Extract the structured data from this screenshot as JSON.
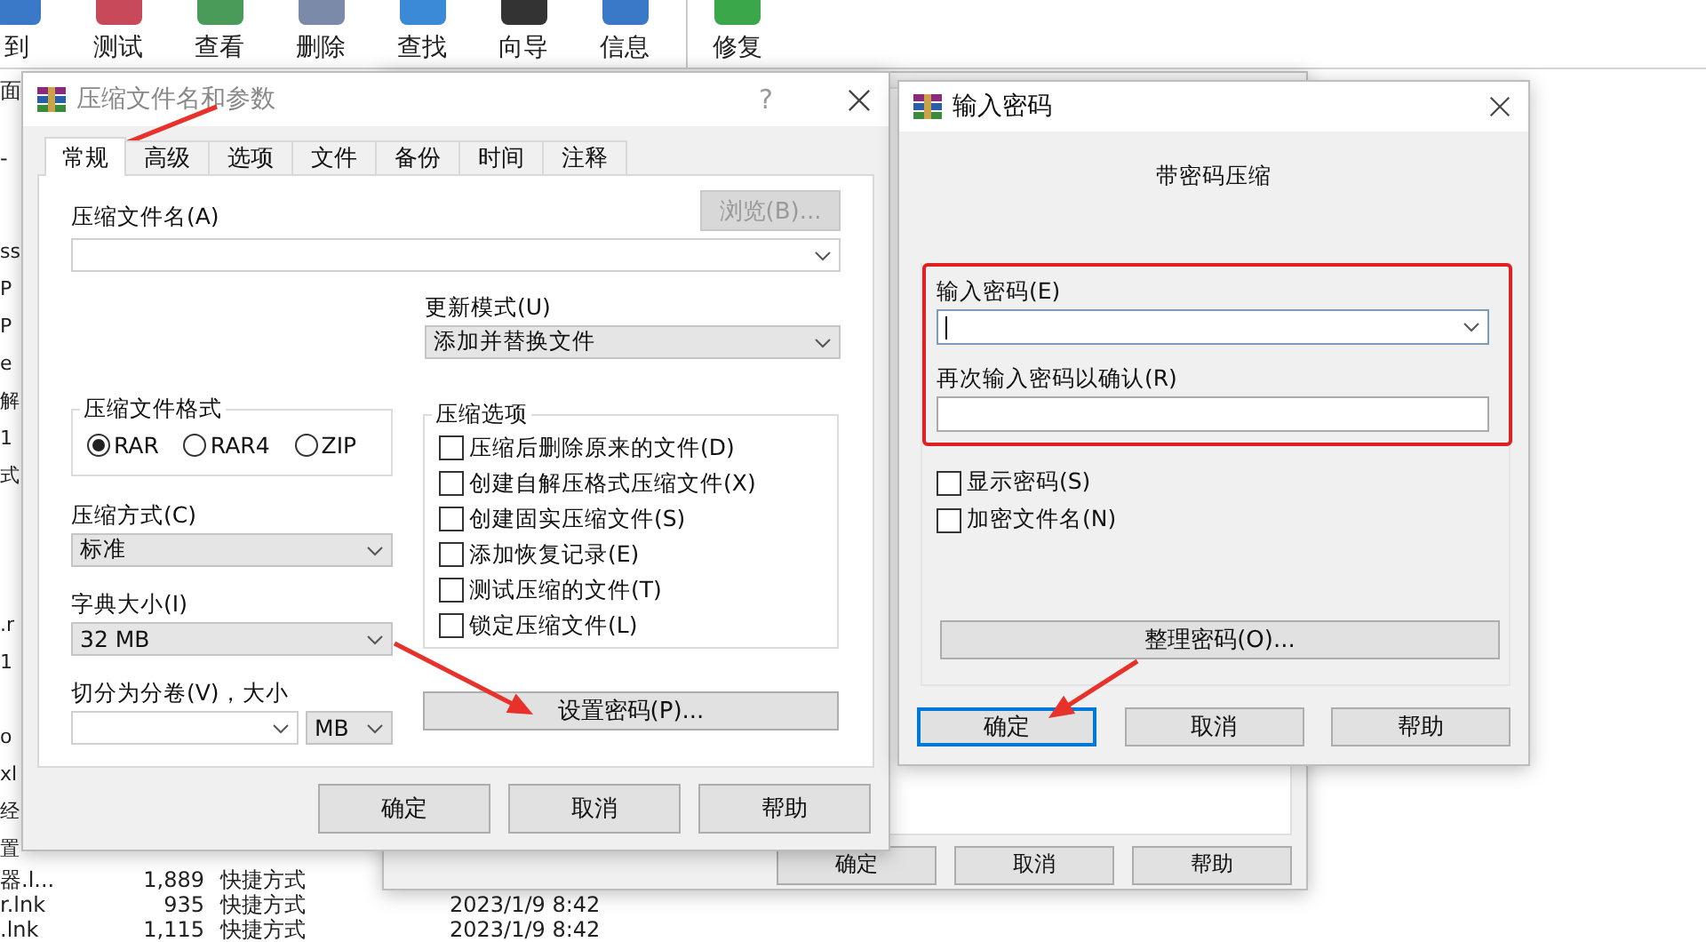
{
  "toolbar": [
    {
      "label": "到",
      "group_start": false
    },
    {
      "label": "测试",
      "group_start": false
    },
    {
      "label": "查看",
      "group_start": false
    },
    {
      "label": "删除",
      "group_start": false
    },
    {
      "label": "查找",
      "group_start": false
    },
    {
      "label": "向导",
      "group_start": false
    },
    {
      "label": "信息",
      "group_start": false
    },
    {
      "label": "修复",
      "group_start": true
    }
  ],
  "file_list": {
    "top_fragments": [
      "面",
      "-"
    ],
    "rows": [
      {
        "name": "ss"
      },
      {
        "name": "P"
      },
      {
        "name": "P"
      },
      {
        "name": "e"
      },
      {
        "name": "解"
      },
      {
        "name": "1"
      },
      {
        "name": "式"
      },
      {},
      {},
      {},
      {
        "name": ".r"
      },
      {
        "name": "1"
      },
      {},
      {
        "name": "o"
      },
      {
        "name": "xl"
      },
      {
        "name": "经"
      },
      {
        "name": "置"
      },
      {
        "name": "器.l...",
        "size": "1,889",
        "type": "快捷方式"
      },
      {
        "name": "r.lnk",
        "size": "935",
        "type": "快捷方式",
        "date": "2023/1/9 8:42"
      },
      {
        "name": ".lnk",
        "size": "1,115",
        "type": "快捷方式",
        "date": "2023/1/9 8:42"
      }
    ]
  },
  "back_dialog": {
    "buttons": [
      "确定",
      "取消",
      "帮助"
    ]
  },
  "archive_dialog": {
    "title": "压缩文件名和参数",
    "help": "?",
    "tabs": [
      {
        "label": "常规",
        "selected": true
      },
      {
        "label": "高级",
        "selected": false
      },
      {
        "label": "选项",
        "selected": false
      },
      {
        "label": "文件",
        "selected": false
      },
      {
        "label": "备份",
        "selected": false
      },
      {
        "label": "时间",
        "selected": false
      },
      {
        "label": "注释",
        "selected": false
      }
    ],
    "archive_name": {
      "label": "压缩文件名(A)",
      "browse": {
        "label": "浏览(B)...",
        "disabled": true
      }
    },
    "update_mode": {
      "label": "更新模式(U)",
      "value": "添加并替换文件"
    },
    "format": {
      "title": "压缩文件格式",
      "options": [
        {
          "label": "RAR",
          "selected": true
        },
        {
          "label": "RAR4",
          "selected": false
        },
        {
          "label": "ZIP",
          "selected": false
        }
      ]
    },
    "method": {
      "label": "压缩方式(C)",
      "value": "标准"
    },
    "dictionary": {
      "label": "字典大小(I)",
      "value": "32 MB"
    },
    "split": {
      "label": "切分为分卷(V)，大小",
      "unit": "MB"
    },
    "options": {
      "title": "压缩选项",
      "items": [
        {
          "label": "压缩后删除原来的文件(D)",
          "checked": false
        },
        {
          "label": "创建自解压格式压缩文件(X)",
          "checked": false
        },
        {
          "label": "创建固实压缩文件(S)",
          "checked": false
        },
        {
          "label": "添加恢复记录(E)",
          "checked": false
        },
        {
          "label": "测试压缩的文件(T)",
          "checked": false
        },
        {
          "label": "锁定压缩文件(L)",
          "checked": false
        }
      ]
    },
    "set_password": "设置密码(P)...",
    "buttons": [
      "确定",
      "取消",
      "帮助"
    ]
  },
  "password_dialog": {
    "title": "输入密码",
    "heading": "带密码压缩",
    "password": {
      "label": "输入密码(E)",
      "focused": true
    },
    "confirm": {
      "label": "再次输入密码以确认(R)",
      "focused": false
    },
    "options": [
      {
        "label": "显示密码(S)",
        "checked": false
      },
      {
        "label": "加密文件名(N)",
        "checked": false
      }
    ],
    "organize": "整理密码(O)...",
    "buttons": [
      {
        "label": "确定",
        "default": true
      },
      {
        "label": "取消",
        "default": false
      },
      {
        "label": "帮助",
        "default": false
      }
    ]
  }
}
